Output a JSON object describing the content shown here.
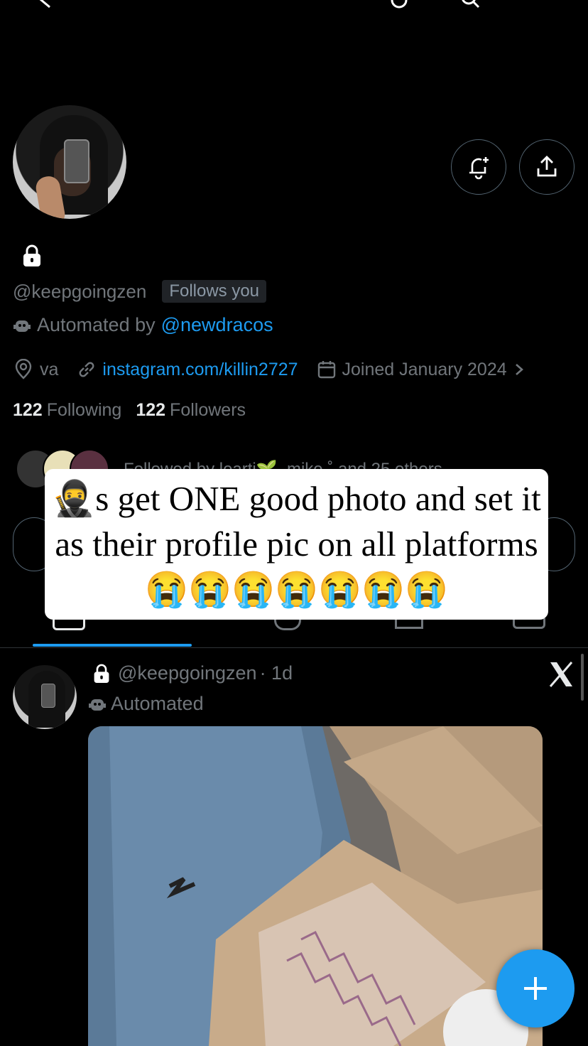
{
  "profile": {
    "handle": "@keepgoingzen",
    "follows_you": "Follows you",
    "automated_prefix": "Automated by",
    "automated_by": "@newdracos",
    "location": "va",
    "website": "instagram.com/killin2727",
    "joined": "Joined January 2024",
    "following_count": "122",
    "following_label": "Following",
    "followers_count": "122",
    "followers_label": "Followers",
    "followed_by_text": "Followed by learti🌱, mike ˚ and 25 others"
  },
  "overlay_caption": "🥷s get ONE good photo and set it as their profile pic on all platforms 😭😭😭😭😭😭😭",
  "post": {
    "handle": "@keepgoingzen",
    "time": "· 1d",
    "automated": "Automated"
  },
  "icons": {
    "lock": "lock-icon",
    "notify": "bell-plus-icon",
    "share": "share-icon",
    "location": "location-icon",
    "link": "link-icon",
    "calendar": "calendar-icon",
    "bot": "bot-icon",
    "x": "x-logo",
    "compose": "plus-icon"
  },
  "colors": {
    "accent": "#1d9bf0",
    "muted": "#71767b",
    "background": "#000000"
  }
}
